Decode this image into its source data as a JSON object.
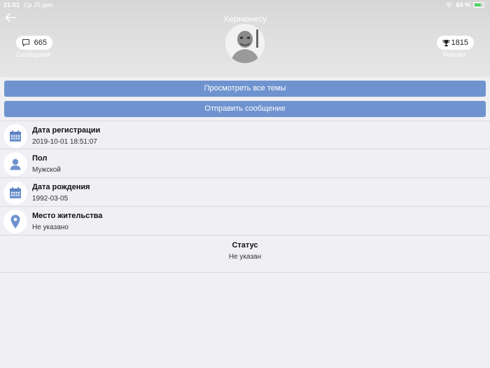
{
  "status_bar": {
    "time": "21:51",
    "date": "Ср 25 дек.",
    "battery": "64 %"
  },
  "profile": {
    "username": "Хернюнесу",
    "posts_count": "665",
    "posts_label": "Сообщений",
    "rating_count": "1815",
    "rating_label": "Рейтинг"
  },
  "actions": {
    "view_topics": "Просмотреть все темы",
    "send_message": "Отправить сообщение"
  },
  "info": [
    {
      "title": "Дата регистрации",
      "value": "2019-10-01 18:51:07",
      "icon": "calendar-icon"
    },
    {
      "title": "Пол",
      "value": "Мужской",
      "icon": "person-icon"
    },
    {
      "title": "Дата рождения",
      "value": "1992-03-05",
      "icon": "calendar-icon"
    },
    {
      "title": "Место жительства",
      "value": "Не указано",
      "icon": "location-pin-icon"
    }
  ],
  "status": {
    "title": "Статус",
    "value": "Не указан"
  },
  "colors": {
    "accent": "#6f93cf",
    "background": "#efeff4"
  }
}
